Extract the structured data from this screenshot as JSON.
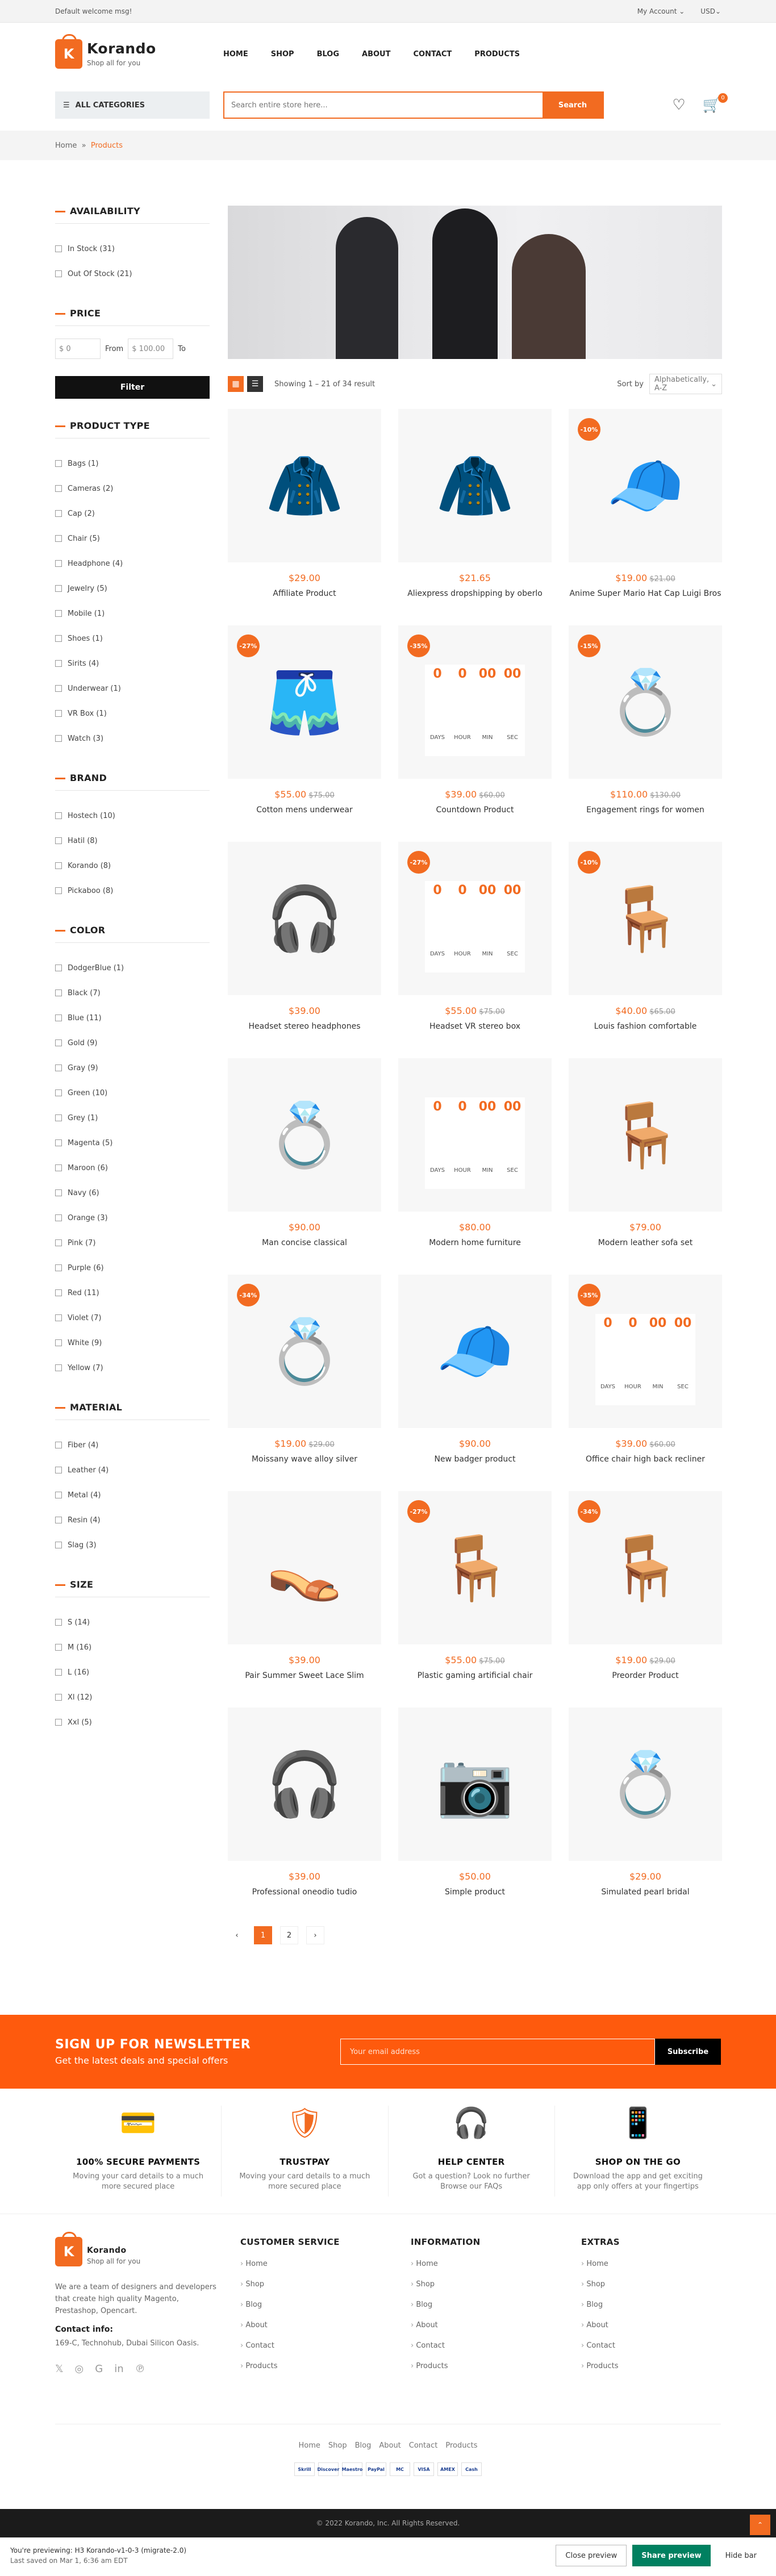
{
  "topbar": {
    "welcome": "Default welcome msg!",
    "account": "My Account ⌄",
    "currency": "USD⌄"
  },
  "logo": {
    "letter": "K",
    "name": "Korando",
    "tag": "Shop all for you"
  },
  "nav": [
    "HOME",
    "SHOP",
    "BLOG",
    "ABOUT",
    "CONTACT",
    "PRODUCTS"
  ],
  "search": {
    "allcat": "ALL CATEGORIES",
    "placeholder": "Search entire store here...",
    "button": "Search",
    "cart_count": "0"
  },
  "crumb": {
    "home": "Home",
    "sep": "»",
    "current": "Products"
  },
  "filters": {
    "availability": {
      "title": "AVAILABILITY",
      "items": [
        "In Stock (31)",
        "Out Of Stock (21)"
      ]
    },
    "price": {
      "title": "PRICE",
      "from_val": "$ 0",
      "from": "From",
      "to_val": "$ 100.00",
      "to": "To",
      "button": "Filter"
    },
    "ptype": {
      "title": "PRODUCT TYPE",
      "items": [
        "Bags (1)",
        "Cameras (2)",
        "Cap (2)",
        "Chair (5)",
        "Headphone (4)",
        "Jewelry (5)",
        "Mobile (1)",
        "Shoes (1)",
        "Sirits (4)",
        "Underwear (1)",
        "VR Box (1)",
        "Watch (3)"
      ]
    },
    "brand": {
      "title": "BRAND",
      "items": [
        "Hostech (10)",
        "Hatil (8)",
        "Korando (8)",
        "Pickaboo (8)"
      ]
    },
    "color": {
      "title": "COLOR",
      "items": [
        "DodgerBlue (1)",
        "Black (7)",
        "Blue (11)",
        "Gold (9)",
        "Gray (9)",
        "Green (10)",
        "Grey (1)",
        "Magenta (5)",
        "Maroon (6)",
        "Navy (6)",
        "Orange (3)",
        "Pink (7)",
        "Purple (6)",
        "Red (11)",
        "Violet (7)",
        "White (9)",
        "Yellow (7)"
      ]
    },
    "material": {
      "title": "MATERIAL",
      "items": [
        "Fiber (4)",
        "Leather (4)",
        "Metal (4)",
        "Resin (4)",
        "Slag (3)"
      ]
    },
    "size": {
      "title": "SIZE",
      "items": [
        "S (14)",
        "M (16)",
        "L (16)",
        "Xl (12)",
        "Xxl (5)"
      ]
    }
  },
  "toolbar": {
    "grid_icon": "▦",
    "list_icon": "☰",
    "showing": "Showing 1 – 21 of 34 result",
    "sort_label": "Sort by",
    "sort_value": "Alphabetically, A-Z"
  },
  "countdown": {
    "days": "0",
    "hour": "0",
    "min": "00",
    "sec": "00",
    "l_days": "DAYS",
    "l_hour": "HOUR",
    "l_min": "MIN",
    "l_sec": "SEC"
  },
  "products": [
    {
      "name": "Affiliate Product",
      "price": "$29.00",
      "old": "",
      "sale": "",
      "icon": "🧥",
      "cd": false
    },
    {
      "name": "Aliexpress dropshipping by oberlo",
      "price": "$21.65",
      "old": "",
      "sale": "",
      "icon": "🧥",
      "cd": false
    },
    {
      "name": "Anime Super Mario Hat Cap Luigi Bros",
      "price": "$19.00",
      "old": "$21.00",
      "sale": "-10%",
      "icon": "🧢",
      "cd": false
    },
    {
      "name": "Cotton mens underwear",
      "price": "$55.00",
      "old": "$75.00",
      "sale": "-27%",
      "icon": "🩳",
      "cd": false
    },
    {
      "name": "Countdown Product",
      "price": "$39.00",
      "old": "$60.00",
      "sale": "-35%",
      "icon": "⌚",
      "cd": true
    },
    {
      "name": "Engagement rings for women",
      "price": "$110.00",
      "old": "$130.00",
      "sale": "-15%",
      "icon": "💍",
      "cd": false
    },
    {
      "name": "Headset stereo headphones",
      "price": "$39.00",
      "old": "",
      "sale": "",
      "icon": "🎧",
      "cd": false
    },
    {
      "name": "Headset VR stereo box",
      "price": "$55.00",
      "old": "$75.00",
      "sale": "-27%",
      "icon": "🥽",
      "cd": true
    },
    {
      "name": "Louis fashion comfortable",
      "price": "$40.00",
      "old": "$65.00",
      "sale": "-10%",
      "icon": "🪑",
      "cd": false
    },
    {
      "name": "Man concise classical",
      "price": "$90.00",
      "old": "",
      "sale": "",
      "icon": "💍",
      "cd": false
    },
    {
      "name": "Modern home furniture",
      "price": "$80.00",
      "old": "",
      "sale": "",
      "icon": "🛋",
      "cd": true
    },
    {
      "name": "Modern leather sofa set",
      "price": "$79.00",
      "old": "",
      "sale": "",
      "icon": "🪑",
      "cd": false
    },
    {
      "name": "Moissany wave alloy silver",
      "price": "$19.00",
      "old": "$29.00",
      "sale": "-34%",
      "icon": "💍",
      "cd": false
    },
    {
      "name": "New badger product",
      "price": "$90.00",
      "old": "",
      "sale": "",
      "icon": "🧢",
      "cd": false
    },
    {
      "name": "Office chair high back recliner",
      "price": "$39.00",
      "old": "$60.00",
      "sale": "-35%",
      "icon": "💺",
      "cd": true
    },
    {
      "name": "Pair Summer Sweet Lace Slim",
      "price": "$39.00",
      "old": "",
      "sale": "",
      "icon": "👡",
      "cd": false
    },
    {
      "name": "Plastic gaming artificial chair",
      "price": "$55.00",
      "old": "$75.00",
      "sale": "-27%",
      "icon": "🪑",
      "cd": false
    },
    {
      "name": "Preorder Product",
      "price": "$19.00",
      "old": "$29.00",
      "sale": "-34%",
      "icon": "🪑",
      "cd": false
    },
    {
      "name": "Professional oneodio tudio",
      "price": "$39.00",
      "old": "",
      "sale": "",
      "icon": "🎧",
      "cd": false
    },
    {
      "name": "Simple product",
      "price": "$50.00",
      "old": "",
      "sale": "",
      "icon": "📷",
      "cd": false
    },
    {
      "name": "Simulated pearl bridal",
      "price": "$29.00",
      "old": "",
      "sale": "",
      "icon": "💍",
      "cd": false
    }
  ],
  "pagination": {
    "prev": "‹",
    "p1": "1",
    "p2": "2",
    "next": "›"
  },
  "newsletter": {
    "title": "SIGN UP FOR NEWSLETTER",
    "sub": "Get the latest deals and special offers",
    "placeholder": "Your email address",
    "button": "Subscribe"
  },
  "features": [
    {
      "icon": "💳",
      "title": "100% SECURE PAYMENTS",
      "text": "Moving your card details to a much more secured place"
    },
    {
      "icon": "🛡",
      "title": "TRUSTPAY",
      "text": "Moving your card details to a much more secured place"
    },
    {
      "icon": "🎧",
      "title": "HELP CENTER",
      "text": "Got a question? Look no further Browse our FAQs"
    },
    {
      "icon": "📱",
      "title": "SHOP ON THE GO",
      "text": "Download the app and get exciting app only offers at your fingertips"
    }
  ],
  "footer": {
    "about": "We are a team of designers and developers that create high quality Magento, Prestashop, Opencart.",
    "contact_title": "Contact info:",
    "address": "169-C, Technohub, Dubai Silicon Oasis.",
    "social": [
      "𝕏",
      "◎",
      "G",
      "in",
      "℗"
    ],
    "cols": [
      {
        "title": "CUSTOMER SERVICE",
        "links": [
          "Home",
          "Shop",
          "Blog",
          "About",
          "Contact",
          "Products"
        ]
      },
      {
        "title": "INFORMATION",
        "links": [
          "Home",
          "Shop",
          "Blog",
          "About",
          "Contact",
          "Products"
        ]
      },
      {
        "title": "EXTRAS",
        "links": [
          "Home",
          "Shop",
          "Blog",
          "About",
          "Contact",
          "Products"
        ]
      }
    ],
    "bottom_links": [
      "Home",
      "Shop",
      "Blog",
      "About",
      "Contact",
      "Products"
    ],
    "payments": [
      "Skrill",
      "Discover",
      "Maestro",
      "PayPal",
      "MC",
      "VISA",
      "AMEX",
      "Cash"
    ],
    "copyright": "© 2022 Korando, Inc. All Rights Reserved."
  },
  "preview": {
    "line1": "You're previewing: H3 Korando-v1-0-3 (migrate-2.0)",
    "line2": "Last saved on Mar 1, 6:36 am EDT",
    "close": "Close preview",
    "share": "Share preview",
    "hide": "Hide bar"
  },
  "colors": {
    "accent": "#f26b21"
  }
}
